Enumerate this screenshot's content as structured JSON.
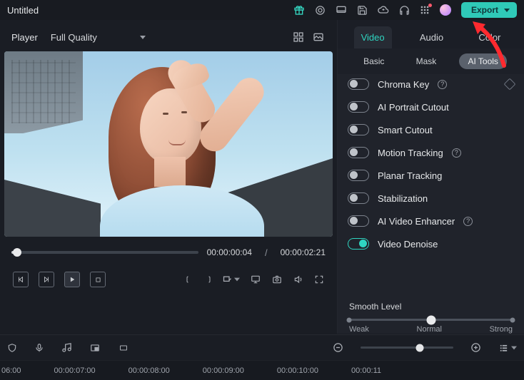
{
  "title": "Untitled",
  "export_label": "Export",
  "player": {
    "tab_label": "Player",
    "quality_label": "Full Quality",
    "current_time": "00:00:00:04",
    "total_time": "00:00:02:21"
  },
  "right_panel": {
    "tabs_primary": [
      "Video",
      "Audio",
      "Color"
    ],
    "tabs_primary_active": "Video",
    "tabs_secondary": [
      "Basic",
      "Mask",
      "AI Tools"
    ],
    "tabs_secondary_active": "AI Tools",
    "ai_tools": [
      {
        "label": "Chroma Key",
        "on": false,
        "help": true,
        "diamond": true
      },
      {
        "label": "AI Portrait Cutout",
        "on": false,
        "help": false,
        "diamond": false
      },
      {
        "label": "Smart Cutout",
        "on": false,
        "help": false,
        "diamond": false
      },
      {
        "label": "Motion Tracking",
        "on": false,
        "help": true,
        "diamond": false
      },
      {
        "label": "Planar Tracking",
        "on": false,
        "help": false,
        "diamond": false
      },
      {
        "label": "Stabilization",
        "on": false,
        "help": false,
        "diamond": false
      },
      {
        "label": "AI Video Enhancer",
        "on": false,
        "help": true,
        "diamond": false
      },
      {
        "label": "Video Denoise",
        "on": true,
        "help": false,
        "diamond": false
      }
    ],
    "smooth": {
      "title": "Smooth Level",
      "labels": [
        "Weak",
        "Normal",
        "Strong"
      ]
    }
  },
  "timeline_marks": [
    "06:00",
    "00:00:07:00",
    "00:00:08:00",
    "00:00:09:00",
    "00:00:10:00",
    "00:00:11"
  ]
}
